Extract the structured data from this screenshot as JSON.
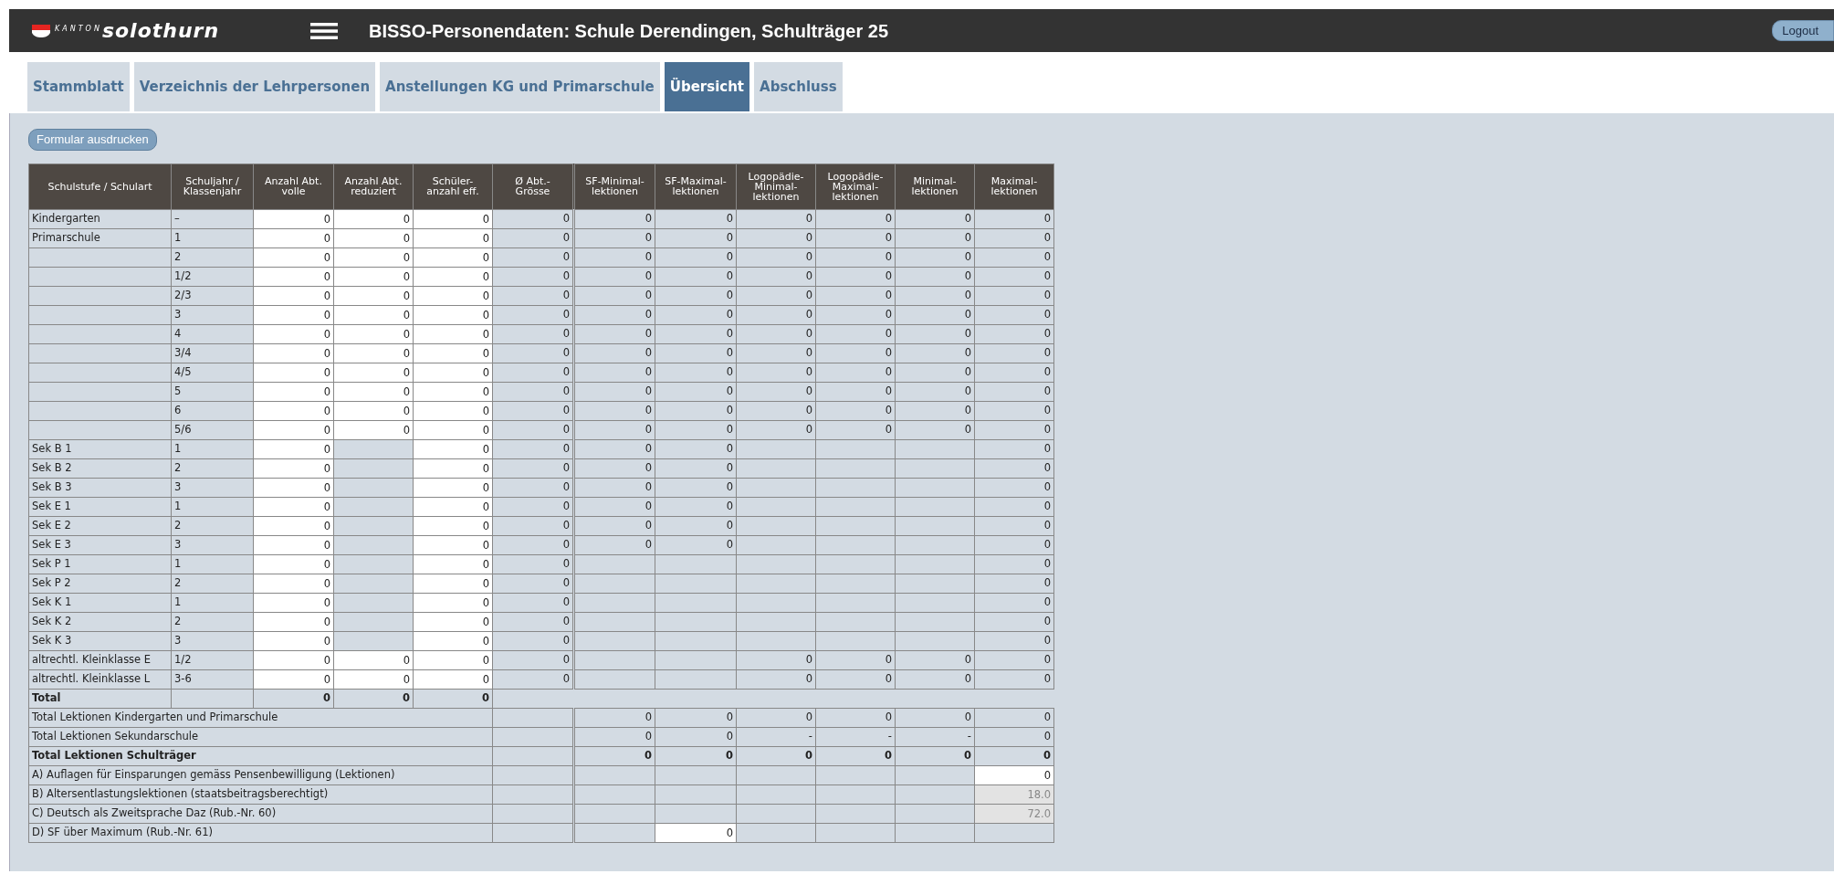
{
  "header": {
    "logo_small": "KANTON",
    "logo": "solothurn",
    "title": "BISSO-Personendaten: Schule Derendingen, Schulträger 25",
    "logout": "Logout"
  },
  "tabs": [
    {
      "label": "Stammblatt",
      "selected": false
    },
    {
      "label": "Verzeichnis der Lehrpersonen",
      "selected": false
    },
    {
      "label": "Anstellungen KG und Primarschule",
      "selected": false
    },
    {
      "label": "Übersicht",
      "selected": true
    },
    {
      "label": "Abschluss",
      "selected": false
    }
  ],
  "print_button": "Formular ausdrucken",
  "table": {
    "columns": [
      "Schulstufe / Schulart",
      "Schuljahr /\nKlassenjahr",
      "Anzahl Abt.\nvolle",
      "Anzahl Abt.\nreduziert",
      "Schüler-\nanzahl eff.",
      "Ø Abt.-\nGrösse",
      "SF-Minimal-\nlektionen",
      "SF-Maximal-\nlektionen",
      "Logopädie-\nMinimal-\nlektionen",
      "Logopädie-\nMaximal-\nlektionen",
      "Minimal-\nlektionen",
      "Maximal-\nlektionen"
    ],
    "rows": [
      {
        "cells": [
          {
            "kind": "label",
            "text": "Kindergarten"
          },
          {
            "kind": "label",
            "text": "–"
          },
          {
            "kind": "input",
            "text": "0"
          },
          {
            "kind": "input",
            "text": "0"
          },
          {
            "kind": "input",
            "text": "0"
          },
          {
            "kind": "value",
            "text": "0"
          },
          {
            "kind": "value",
            "text": "0"
          },
          {
            "kind": "value",
            "text": "0"
          },
          {
            "kind": "value",
            "text": "0"
          },
          {
            "kind": "value",
            "text": "0"
          },
          {
            "kind": "value",
            "text": "0"
          },
          {
            "kind": "value",
            "text": "0"
          }
        ]
      },
      {
        "cells": [
          {
            "kind": "label",
            "text": "Primarschule"
          },
          {
            "kind": "label",
            "text": "1"
          },
          {
            "kind": "input",
            "text": "0"
          },
          {
            "kind": "input",
            "text": "0"
          },
          {
            "kind": "input",
            "text": "0"
          },
          {
            "kind": "value",
            "text": "0"
          },
          {
            "kind": "value",
            "text": "0"
          },
          {
            "kind": "value",
            "text": "0"
          },
          {
            "kind": "value",
            "text": "0"
          },
          {
            "kind": "value",
            "text": "0"
          },
          {
            "kind": "value",
            "text": "0"
          },
          {
            "kind": "value",
            "text": "0"
          }
        ]
      },
      {
        "cells": [
          null,
          {
            "kind": "label",
            "text": "2"
          },
          {
            "kind": "input",
            "text": "0"
          },
          {
            "kind": "input",
            "text": "0"
          },
          {
            "kind": "input",
            "text": "0"
          },
          {
            "kind": "value",
            "text": "0"
          },
          {
            "kind": "value",
            "text": "0"
          },
          {
            "kind": "value",
            "text": "0"
          },
          {
            "kind": "value",
            "text": "0"
          },
          {
            "kind": "value",
            "text": "0"
          },
          {
            "kind": "value",
            "text": "0"
          },
          {
            "kind": "value",
            "text": "0"
          }
        ]
      },
      {
        "cells": [
          null,
          {
            "kind": "label",
            "text": "1/2"
          },
          {
            "kind": "input",
            "text": "0"
          },
          {
            "kind": "input",
            "text": "0"
          },
          {
            "kind": "input",
            "text": "0"
          },
          {
            "kind": "value",
            "text": "0"
          },
          {
            "kind": "value",
            "text": "0"
          },
          {
            "kind": "value",
            "text": "0"
          },
          {
            "kind": "value",
            "text": "0"
          },
          {
            "kind": "value",
            "text": "0"
          },
          {
            "kind": "value",
            "text": "0"
          },
          {
            "kind": "value",
            "text": "0"
          }
        ]
      },
      {
        "cells": [
          null,
          {
            "kind": "label",
            "text": "2/3"
          },
          {
            "kind": "input",
            "text": "0"
          },
          {
            "kind": "input",
            "text": "0"
          },
          {
            "kind": "input",
            "text": "0"
          },
          {
            "kind": "value",
            "text": "0"
          },
          {
            "kind": "value",
            "text": "0"
          },
          {
            "kind": "value",
            "text": "0"
          },
          {
            "kind": "value",
            "text": "0"
          },
          {
            "kind": "value",
            "text": "0"
          },
          {
            "kind": "value",
            "text": "0"
          },
          {
            "kind": "value",
            "text": "0"
          }
        ]
      },
      {
        "cells": [
          null,
          {
            "kind": "label",
            "text": "3"
          },
          {
            "kind": "input",
            "text": "0"
          },
          {
            "kind": "input",
            "text": "0"
          },
          {
            "kind": "input",
            "text": "0"
          },
          {
            "kind": "value",
            "text": "0"
          },
          {
            "kind": "value",
            "text": "0"
          },
          {
            "kind": "value",
            "text": "0"
          },
          {
            "kind": "value",
            "text": "0"
          },
          {
            "kind": "value",
            "text": "0"
          },
          {
            "kind": "value",
            "text": "0"
          },
          {
            "kind": "value",
            "text": "0"
          }
        ]
      },
      {
        "cells": [
          null,
          {
            "kind": "label",
            "text": "4"
          },
          {
            "kind": "input",
            "text": "0"
          },
          {
            "kind": "input",
            "text": "0"
          },
          {
            "kind": "input",
            "text": "0"
          },
          {
            "kind": "value",
            "text": "0"
          },
          {
            "kind": "value",
            "text": "0"
          },
          {
            "kind": "value",
            "text": "0"
          },
          {
            "kind": "value",
            "text": "0"
          },
          {
            "kind": "value",
            "text": "0"
          },
          {
            "kind": "value",
            "text": "0"
          },
          {
            "kind": "value",
            "text": "0"
          }
        ]
      },
      {
        "cells": [
          null,
          {
            "kind": "label",
            "text": "3/4"
          },
          {
            "kind": "input",
            "text": "0"
          },
          {
            "kind": "input",
            "text": "0"
          },
          {
            "kind": "input",
            "text": "0"
          },
          {
            "kind": "value",
            "text": "0"
          },
          {
            "kind": "value",
            "text": "0"
          },
          {
            "kind": "value",
            "text": "0"
          },
          {
            "kind": "value",
            "text": "0"
          },
          {
            "kind": "value",
            "text": "0"
          },
          {
            "kind": "value",
            "text": "0"
          },
          {
            "kind": "value",
            "text": "0"
          }
        ]
      },
      {
        "cells": [
          null,
          {
            "kind": "label",
            "text": "4/5"
          },
          {
            "kind": "input",
            "text": "0"
          },
          {
            "kind": "input",
            "text": "0"
          },
          {
            "kind": "input",
            "text": "0"
          },
          {
            "kind": "value",
            "text": "0"
          },
          {
            "kind": "value",
            "text": "0"
          },
          {
            "kind": "value",
            "text": "0"
          },
          {
            "kind": "value",
            "text": "0"
          },
          {
            "kind": "value",
            "text": "0"
          },
          {
            "kind": "value",
            "text": "0"
          },
          {
            "kind": "value",
            "text": "0"
          }
        ]
      },
      {
        "cells": [
          null,
          {
            "kind": "label",
            "text": "5"
          },
          {
            "kind": "input",
            "text": "0"
          },
          {
            "kind": "input",
            "text": "0"
          },
          {
            "kind": "input",
            "text": "0"
          },
          {
            "kind": "value",
            "text": "0"
          },
          {
            "kind": "value",
            "text": "0"
          },
          {
            "kind": "value",
            "text": "0"
          },
          {
            "kind": "value",
            "text": "0"
          },
          {
            "kind": "value",
            "text": "0"
          },
          {
            "kind": "value",
            "text": "0"
          },
          {
            "kind": "value",
            "text": "0"
          }
        ]
      },
      {
        "cells": [
          null,
          {
            "kind": "label",
            "text": "6"
          },
          {
            "kind": "input",
            "text": "0"
          },
          {
            "kind": "input",
            "text": "0"
          },
          {
            "kind": "input",
            "text": "0"
          },
          {
            "kind": "value",
            "text": "0"
          },
          {
            "kind": "value",
            "text": "0"
          },
          {
            "kind": "value",
            "text": "0"
          },
          {
            "kind": "value",
            "text": "0"
          },
          {
            "kind": "value",
            "text": "0"
          },
          {
            "kind": "value",
            "text": "0"
          },
          {
            "kind": "value",
            "text": "0"
          }
        ]
      },
      {
        "cells": [
          null,
          {
            "kind": "label",
            "text": "5/6"
          },
          {
            "kind": "input",
            "text": "0"
          },
          {
            "kind": "input",
            "text": "0"
          },
          {
            "kind": "input",
            "text": "0"
          },
          {
            "kind": "value",
            "text": "0"
          },
          {
            "kind": "value",
            "text": "0"
          },
          {
            "kind": "value",
            "text": "0"
          },
          {
            "kind": "value",
            "text": "0"
          },
          {
            "kind": "value",
            "text": "0"
          },
          {
            "kind": "value",
            "text": "0"
          },
          {
            "kind": "value",
            "text": "0"
          }
        ]
      },
      {
        "cells": [
          {
            "kind": "label",
            "text": "Sek B 1"
          },
          {
            "kind": "label",
            "text": "1"
          },
          {
            "kind": "input",
            "text": "0"
          },
          null,
          {
            "kind": "input",
            "text": "0"
          },
          {
            "kind": "value",
            "text": "0"
          },
          {
            "kind": "value",
            "text": "0"
          },
          {
            "kind": "value",
            "text": "0"
          },
          null,
          null,
          null,
          {
            "kind": "value",
            "text": "0"
          }
        ]
      },
      {
        "cells": [
          {
            "kind": "label",
            "text": "Sek B 2"
          },
          {
            "kind": "label",
            "text": "2"
          },
          {
            "kind": "input",
            "text": "0"
          },
          null,
          {
            "kind": "input",
            "text": "0"
          },
          {
            "kind": "value",
            "text": "0"
          },
          {
            "kind": "value",
            "text": "0"
          },
          {
            "kind": "value",
            "text": "0"
          },
          null,
          null,
          null,
          {
            "kind": "value",
            "text": "0"
          }
        ]
      },
      {
        "cells": [
          {
            "kind": "label",
            "text": "Sek B 3"
          },
          {
            "kind": "label",
            "text": "3"
          },
          {
            "kind": "input",
            "text": "0"
          },
          null,
          {
            "kind": "input",
            "text": "0"
          },
          {
            "kind": "value",
            "text": "0"
          },
          {
            "kind": "value",
            "text": "0"
          },
          {
            "kind": "value",
            "text": "0"
          },
          null,
          null,
          null,
          {
            "kind": "value",
            "text": "0"
          }
        ]
      },
      {
        "cells": [
          {
            "kind": "label",
            "text": "Sek E 1"
          },
          {
            "kind": "label",
            "text": "1"
          },
          {
            "kind": "input",
            "text": "0"
          },
          null,
          {
            "kind": "input",
            "text": "0"
          },
          {
            "kind": "value",
            "text": "0"
          },
          {
            "kind": "value",
            "text": "0"
          },
          {
            "kind": "value",
            "text": "0"
          },
          null,
          null,
          null,
          {
            "kind": "value",
            "text": "0"
          }
        ]
      },
      {
        "cells": [
          {
            "kind": "label",
            "text": "Sek E 2"
          },
          {
            "kind": "label",
            "text": "2"
          },
          {
            "kind": "input",
            "text": "0"
          },
          null,
          {
            "kind": "input",
            "text": "0"
          },
          {
            "kind": "value",
            "text": "0"
          },
          {
            "kind": "value",
            "text": "0"
          },
          {
            "kind": "value",
            "text": "0"
          },
          null,
          null,
          null,
          {
            "kind": "value",
            "text": "0"
          }
        ]
      },
      {
        "cells": [
          {
            "kind": "label",
            "text": "Sek E 3"
          },
          {
            "kind": "label",
            "text": "3"
          },
          {
            "kind": "input",
            "text": "0"
          },
          null,
          {
            "kind": "input",
            "text": "0"
          },
          {
            "kind": "value",
            "text": "0"
          },
          {
            "kind": "value",
            "text": "0"
          },
          {
            "kind": "value",
            "text": "0"
          },
          null,
          null,
          null,
          {
            "kind": "value",
            "text": "0"
          }
        ]
      },
      {
        "cells": [
          {
            "kind": "label",
            "text": "Sek P 1"
          },
          {
            "kind": "label",
            "text": "1"
          },
          {
            "kind": "input",
            "text": "0"
          },
          null,
          {
            "kind": "input",
            "text": "0"
          },
          {
            "kind": "value",
            "text": "0"
          },
          null,
          null,
          null,
          null,
          null,
          {
            "kind": "value",
            "text": "0"
          }
        ]
      },
      {
        "cells": [
          {
            "kind": "label",
            "text": "Sek P 2"
          },
          {
            "kind": "label",
            "text": "2"
          },
          {
            "kind": "input",
            "text": "0"
          },
          null,
          {
            "kind": "input",
            "text": "0"
          },
          {
            "kind": "value",
            "text": "0"
          },
          null,
          null,
          null,
          null,
          null,
          {
            "kind": "value",
            "text": "0"
          }
        ]
      },
      {
        "cells": [
          {
            "kind": "label",
            "text": "Sek K 1"
          },
          {
            "kind": "label",
            "text": "1"
          },
          {
            "kind": "input",
            "text": "0"
          },
          null,
          {
            "kind": "input",
            "text": "0"
          },
          {
            "kind": "value",
            "text": "0"
          },
          null,
          null,
          null,
          null,
          null,
          {
            "kind": "value",
            "text": "0"
          }
        ]
      },
      {
        "cells": [
          {
            "kind": "label",
            "text": "Sek K 2"
          },
          {
            "kind": "label",
            "text": "2"
          },
          {
            "kind": "input",
            "text": "0"
          },
          null,
          {
            "kind": "input",
            "text": "0"
          },
          {
            "kind": "value",
            "text": "0"
          },
          null,
          null,
          null,
          null,
          null,
          {
            "kind": "value",
            "text": "0"
          }
        ]
      },
      {
        "cells": [
          {
            "kind": "label",
            "text": "Sek K 3"
          },
          {
            "kind": "label",
            "text": "3"
          },
          {
            "kind": "input",
            "text": "0"
          },
          null,
          {
            "kind": "input",
            "text": "0"
          },
          {
            "kind": "value",
            "text": "0"
          },
          null,
          null,
          null,
          null,
          null,
          {
            "kind": "value",
            "text": "0"
          }
        ]
      },
      {
        "cells": [
          {
            "kind": "label",
            "text": "altrechtl. Kleinklasse E"
          },
          {
            "kind": "label",
            "text": "1/2"
          },
          {
            "kind": "input",
            "text": "0"
          },
          {
            "kind": "input",
            "text": "0"
          },
          {
            "kind": "input",
            "text": "0"
          },
          {
            "kind": "value",
            "text": "0"
          },
          null,
          null,
          {
            "kind": "value",
            "text": "0"
          },
          {
            "kind": "value",
            "text": "0"
          },
          {
            "kind": "value",
            "text": "0"
          },
          {
            "kind": "value",
            "text": "0"
          }
        ]
      },
      {
        "cells": [
          {
            "kind": "label",
            "text": "altrechtl. Kleinklasse L"
          },
          {
            "kind": "label",
            "text": "3-6"
          },
          {
            "kind": "input",
            "text": "0"
          },
          {
            "kind": "input",
            "text": "0"
          },
          {
            "kind": "input",
            "text": "0"
          },
          {
            "kind": "value",
            "text": "0"
          },
          null,
          null,
          {
            "kind": "value",
            "text": "0"
          },
          {
            "kind": "value",
            "text": "0"
          },
          {
            "kind": "value",
            "text": "0"
          },
          {
            "kind": "value",
            "text": "0"
          }
        ]
      },
      {
        "bold": true,
        "cells": [
          {
            "kind": "label",
            "text": "Total"
          },
          null,
          {
            "kind": "value",
            "text": "0"
          },
          {
            "kind": "value",
            "text": "0"
          },
          {
            "kind": "value",
            "text": "0"
          }
        ]
      }
    ],
    "summary_rows": [
      {
        "label": "Total Lektionen Kindergarten und Primarschule",
        "bold": false,
        "cells": [
          null,
          {
            "kind": "value",
            "text": "0"
          },
          {
            "kind": "value",
            "text": "0"
          },
          {
            "kind": "value",
            "text": "0"
          },
          {
            "kind": "value",
            "text": "0"
          },
          {
            "kind": "value",
            "text": "0"
          },
          {
            "kind": "value",
            "text": "0"
          }
        ]
      },
      {
        "label": "Total Lektionen Sekundarschule",
        "bold": false,
        "cells": [
          null,
          {
            "kind": "value",
            "text": "0"
          },
          {
            "kind": "value",
            "text": "0"
          },
          {
            "kind": "value",
            "text": "-"
          },
          {
            "kind": "value",
            "text": "-"
          },
          {
            "kind": "value",
            "text": "-"
          },
          {
            "kind": "value",
            "text": "0"
          }
        ]
      },
      {
        "label": "Total Lektionen Schulträger",
        "bold": true,
        "cells": [
          null,
          {
            "kind": "value",
            "text": "0"
          },
          {
            "kind": "value",
            "text": "0"
          },
          {
            "kind": "value",
            "text": "0"
          },
          {
            "kind": "value",
            "text": "0"
          },
          {
            "kind": "value",
            "text": "0"
          },
          {
            "kind": "value",
            "text": "0"
          }
        ]
      },
      {
        "label": "A) Auflagen für Einsparungen gemäss Pensenbewilligung (Lektionen)",
        "bold": false,
        "cells": [
          null,
          null,
          null,
          null,
          null,
          null,
          {
            "kind": "input",
            "text": "0"
          }
        ]
      },
      {
        "label": "B) Altersentlastungslektionen (staatsbeitragsberechtigt)",
        "bold": false,
        "cells": [
          null,
          null,
          null,
          null,
          null,
          null,
          {
            "kind": "readonly",
            "text": "18.0"
          }
        ]
      },
      {
        "label": "C) Deutsch als Zweitsprache Daz (Rub.-Nr. 60)",
        "bold": false,
        "cells": [
          null,
          null,
          null,
          null,
          null,
          null,
          {
            "kind": "readonly",
            "text": "72.0"
          }
        ]
      },
      {
        "label": "D) SF über Maximum (Rub.-Nr. 61)",
        "bold": false,
        "cells": [
          null,
          null,
          {
            "kind": "input",
            "text": "0"
          },
          null,
          null,
          null,
          null
        ]
      }
    ]
  }
}
